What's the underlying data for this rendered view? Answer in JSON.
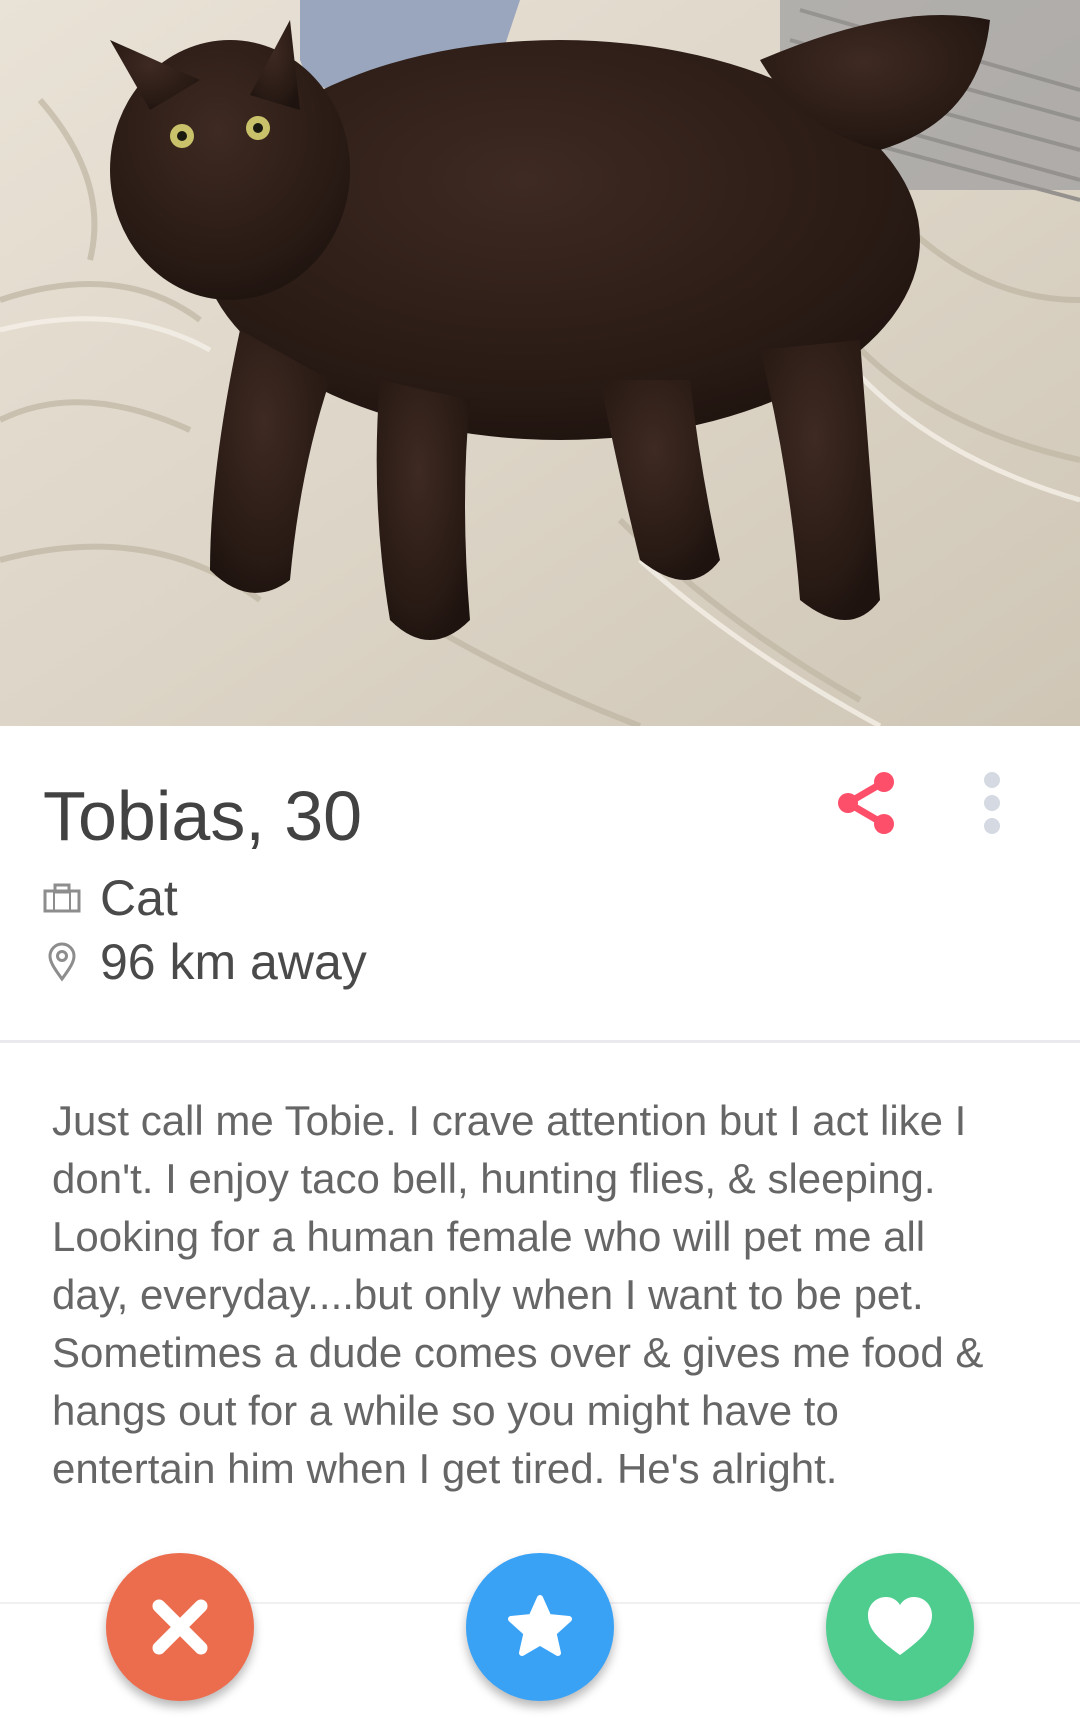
{
  "profile": {
    "name_age": "Tobias, 30",
    "job": "Cat",
    "distance": "96 km away",
    "bio": "Just call me Tobie. I crave attention but I act like I don't. I enjoy taco bell, hunting flies, & sleeping. Looking for a human female who will pet me all day, everyday....but only when I want to be pet. Sometimes a dude comes over & gives me food & hangs out for a while so you might have to entertain him when I get tired. He's alright."
  },
  "icons": {
    "job": "briefcase-icon",
    "distance": "location-pin-icon",
    "share": "share-icon",
    "more": "more-vertical-icon",
    "nope": "close-icon",
    "super_like": "star-icon",
    "like": "heart-icon"
  },
  "colors": {
    "share": "#fd4e6a",
    "more_dots": "#d4d9e2",
    "nope": "#ec6d4e",
    "super_like": "#3aa2f5",
    "like": "#4fcd8f",
    "name_text": "#424242",
    "bio_text": "#666666"
  }
}
